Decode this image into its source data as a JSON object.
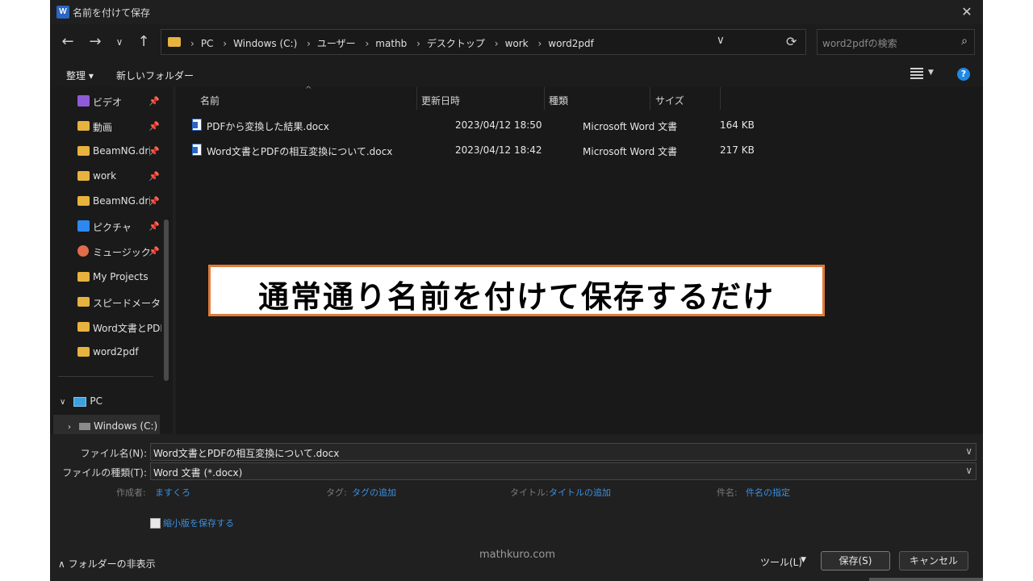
{
  "window": {
    "title": "名前を付けて保存",
    "app_icon_letter": "W"
  },
  "nav": {
    "breadcrumbs": [
      "PC",
      "Windows (C:)",
      "ユーザー",
      "mathb",
      "デスクトップ",
      "work",
      "word2pdf"
    ],
    "search_placeholder": "word2pdfの検索"
  },
  "toolbar": {
    "organize": "整理 ▾",
    "new_folder": "新しいフォルダー"
  },
  "sidebar": {
    "items": [
      {
        "label": "ビデオ",
        "icon": "video-icon",
        "pinned": true
      },
      {
        "label": "動画",
        "icon": "folder-icon",
        "pinned": true
      },
      {
        "label": "BeamNG.drive",
        "icon": "folder-icon",
        "pinned": true
      },
      {
        "label": "work",
        "icon": "folder-icon",
        "pinned": true
      },
      {
        "label": "BeamNG.drive",
        "icon": "folder-icon",
        "pinned": true
      },
      {
        "label": "ピクチャ",
        "icon": "picture-icon",
        "pinned": true
      },
      {
        "label": "ミュージック",
        "icon": "music-icon",
        "pinned": true
      },
      {
        "label": "My Projects",
        "icon": "folder-icon",
        "pinned": false
      },
      {
        "label": "スピードメータをキロ",
        "icon": "folder-icon",
        "pinned": false
      },
      {
        "label": "Word文書とPDFの",
        "icon": "folder-icon",
        "pinned": false
      },
      {
        "label": "word2pdf",
        "icon": "folder-icon",
        "pinned": false
      }
    ],
    "tree": {
      "pc": "PC",
      "drive": "Windows (C:)"
    }
  },
  "files": {
    "columns": [
      "名前",
      "更新日時",
      "種類",
      "サイズ"
    ],
    "rows": [
      {
        "name": "PDFから変換した結果.docx",
        "date": "2023/04/12 18:50",
        "type": "Microsoft Word 文書",
        "size": "164 KB"
      },
      {
        "name": "Word文書とPDFの相互変換について.docx",
        "date": "2023/04/12 18:42",
        "type": "Microsoft Word 文書",
        "size": "217 KB"
      }
    ]
  },
  "form": {
    "filename_label": "ファイル名(N):",
    "filename_value": "Word文書とPDFの相互変換について.docx",
    "filetype_label": "ファイルの種類(T):",
    "filetype_value": "Word 文書 (*.docx)",
    "author_label": "作成者:",
    "author_value": "ますくろ",
    "tags_label": "タグ:",
    "tags_value": "タグの追加",
    "title_label": "タイトル:",
    "title_value": "タイトルの追加",
    "subject_label": "件名:",
    "subject_value": "件名の指定",
    "thumbnail_label": "縮小版を保存する"
  },
  "footer": {
    "hide_folders": "フォルダーの非表示",
    "watermark": "mathkuro.com",
    "tools": "ツール(L)",
    "save": "保存(S)",
    "cancel": "キャンセル"
  },
  "callout": {
    "text": "通常通り名前を付けて保存するだけ",
    "border_color": "#e07b39"
  }
}
